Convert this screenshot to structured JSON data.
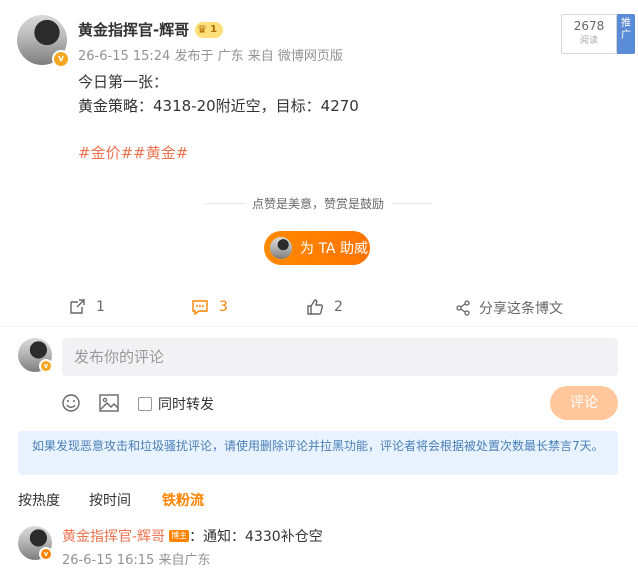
{
  "post": {
    "author": "黄金指挥官-辉哥",
    "level_badge": "1",
    "meta": "26-6-15 15:24 发布于 广东  来自 微博网页版",
    "reads": {
      "count": "2678",
      "label": "阅读"
    },
    "push_label": "推广",
    "lines": [
      "今日第一张：",
      "黄金策略：4318-20附近空，目标：4270"
    ],
    "hashtags": [
      "#金价#",
      "#黄金#"
    ],
    "reward_hint": "点赞是美意，赞赏是鼓励",
    "support_button": "为 TA 助威",
    "actions": {
      "repost": "1",
      "comment": "3",
      "like": "2",
      "share": "分享这条博文"
    }
  },
  "comment_box": {
    "placeholder": "发布你的评论",
    "forward_label": "同时转发",
    "submit_label": "评论"
  },
  "notice": "如果发现恶意攻击和垃圾骚扰评论，请使用删除评论并拉黑功能，评论者将会根据被处置次数最长禁言7天。",
  "tabs": [
    "按热度",
    "按时间",
    "铁粉流"
  ],
  "active_tab": "铁粉流",
  "comment": {
    "author": "黄金指挥官-辉哥",
    "badge": "博主",
    "text": "：通知：4330补仓空",
    "meta": "26-6-15 16:15 来自广东"
  },
  "colors": {
    "accent": "#ff8200",
    "link": "#eb7350",
    "notice_bg": "#e8f3ff"
  }
}
